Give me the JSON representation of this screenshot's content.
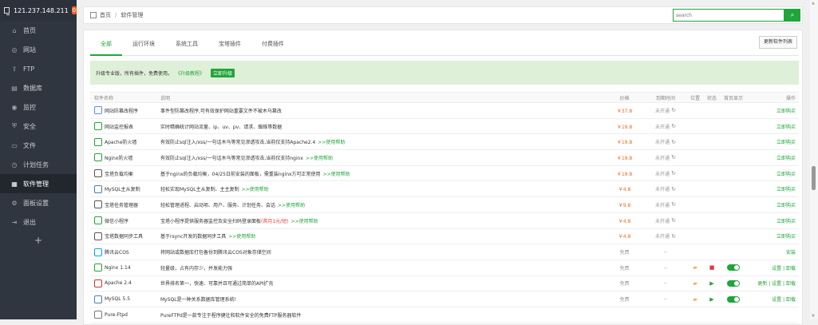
{
  "sidebar": {
    "server_ip": "121.237.148.211",
    "badge": "0",
    "items": [
      {
        "label": "首页",
        "icon": "home-icon",
        "glyph": "⌂"
      },
      {
        "label": "网站",
        "icon": "globe-icon",
        "glyph": "◎"
      },
      {
        "label": "FTP",
        "icon": "upload-icon",
        "glyph": "⇪"
      },
      {
        "label": "数据库",
        "icon": "database-icon",
        "glyph": "▤"
      },
      {
        "label": "监控",
        "icon": "monitor-icon",
        "glyph": "◉"
      },
      {
        "label": "安全",
        "icon": "shield-icon",
        "glyph": "⛨"
      },
      {
        "label": "文件",
        "icon": "folder-icon",
        "glyph": "▭"
      },
      {
        "label": "计划任务",
        "icon": "clock-icon",
        "glyph": "◷"
      },
      {
        "label": "软件管理",
        "icon": "grid-icon",
        "glyph": "▦",
        "active": true
      },
      {
        "label": "面板设置",
        "icon": "gear-icon",
        "glyph": "⚙"
      },
      {
        "label": "退出",
        "icon": "exit-icon",
        "glyph": "⇥"
      }
    ],
    "add": "+"
  },
  "breadcrumb": {
    "home": "首页",
    "sep": "/",
    "current": "软件管理"
  },
  "search": {
    "placeholder": "search",
    "button": "⌕"
  },
  "tabs": [
    "全部",
    "运行环境",
    "系统工具",
    "宝塔插件",
    "付费插件"
  ],
  "update_button": "更新软件列表",
  "promo": {
    "text": "升级专业版，所有插件，免费使用。",
    "link": "《升级教程》",
    "button": "立即升级"
  },
  "table": {
    "headers": {
      "name": "软件名称",
      "desc": "说明",
      "price": "价格",
      "expire": "到期时间",
      "pos": "位置",
      "status": "状态",
      "home": "首页显示",
      "op": "操作"
    },
    "rows": [
      {
        "name": "网站防篡改程序",
        "desc": "事件型防篡改程序,可有效保护网站重要文件不被木马篡改",
        "extra": "",
        "price": "￥37.8",
        "expire": "未开通",
        "refresh": "↻",
        "op": "立即购买",
        "icon_color": "#5b8def"
      },
      {
        "name": "网站监控报表",
        "desc": "实时精确统计网站流量、ip、uv、pv、请求、蜘蛛等数据",
        "extra": "",
        "price": "￥19.8",
        "expire": "未开通",
        "refresh": "↻",
        "op": "立即购买",
        "icon_color": "#20a53a"
      },
      {
        "name": "Apache防火墙",
        "desc": "有效防止sql注入/xss/一句话木马等常见渗透攻击,当前仅支持Apache2.4",
        "extra": ">>使用帮助",
        "price": "￥19.8",
        "expire": "未开通",
        "refresh": "↻",
        "op": "立即购买",
        "icon_color": "#20a53a"
      },
      {
        "name": "Nginx防火墙",
        "desc": "有效防止sql注入/xss/一句话木马等常见渗透攻击,当前仅支持nginx",
        "extra": ">>使用帮助",
        "price": "￥19.8",
        "expire": "未开通",
        "refresh": "↻",
        "op": "立即购买",
        "icon_color": "#20a53a"
      },
      {
        "name": "宝塔负载均衡",
        "desc": "基于nginx的负载均衡，04/25日前安装的面板，需重装nginx方可正常使用",
        "extra": ">>使用帮助",
        "price": "￥19.8",
        "expire": "未开通",
        "refresh": "↻",
        "op": "立即购买",
        "icon_color": "#555"
      },
      {
        "name": "MySQL主从复制",
        "desc": "轻松实现MySQL主从复制、主主复制",
        "extra": ">>使用帮助",
        "price": "￥4.8",
        "expire": "未开通",
        "refresh": "↻",
        "op": "立即购买",
        "icon_color": "#4a7bb7"
      },
      {
        "name": "宝塔任务管理器",
        "desc": "轻松管理进程、启动项、用户、服务、计划任务、会话",
        "extra": ">>使用帮助",
        "price": "￥9.8",
        "expire": "未开通",
        "refresh": "↻",
        "op": "立即购买",
        "icon_color": "#555"
      },
      {
        "name": "微信小程序",
        "desc": "宝塔小程序提供服务器监控及安全扫码登录面板",
        "red": "(首月1元/短)",
        "extra": ">>使用帮助",
        "price": "￥4.8",
        "expire": "未开通",
        "refresh": "↻",
        "op": "立即购买",
        "icon_color": "#20a53a"
      },
      {
        "name": "宝塔数据同步工具",
        "desc": "基于rsync开发的数据同步工具",
        "extra": ">>使用帮助",
        "price": "￥4.8",
        "expire": "未开通",
        "refresh": "↻",
        "op": "立即购买",
        "icon_color": "#555"
      },
      {
        "name": "腾讯云COS",
        "desc": "将网站或数据库打包备份到腾讯云COS对象存储空间",
        "extra": "",
        "price": "免费",
        "expire": "--",
        "refresh": "",
        "op": "安装",
        "icon_color": "#00a3ff"
      },
      {
        "name": "Nginx 1.14",
        "desc": "轻量级，占有内存少，并发能力强",
        "extra": "",
        "price": "免费",
        "expire": "--",
        "refresh": "",
        "pos": "▰",
        "status": "■",
        "status_color": "#e4393c",
        "toggle": true,
        "op": "设置 | 卸载",
        "icon_color": "#20a53a"
      },
      {
        "name": "Apache 2.4",
        "desc": "世界排名第一，快速、可靠并且可通过简单的API扩充",
        "extra": "",
        "price": "免费",
        "expire": "--",
        "refresh": "",
        "pos": "▰",
        "status": "▶",
        "status_color": "#20a53a",
        "toggle": true,
        "op": "更新 | 设置 | 卸载",
        "icon_color": "#c0392b"
      },
      {
        "name": "MySQL 5.5",
        "desc": "MySQL是一种关系数据库管理系统!",
        "extra": "",
        "price": "免费",
        "expire": "--",
        "refresh": "",
        "pos": "▰",
        "status": "▶",
        "status_color": "#20a53a",
        "toggle": true,
        "op": "设置 | 卸载",
        "icon_color": "#4a7bb7"
      },
      {
        "name": "Pure-Ftpd",
        "desc": "PureFTPd是一款专注于程序健壮和软件安全的免费FTP服务器软件",
        "extra": "",
        "price": "",
        "expire": "",
        "refresh": "",
        "op": "",
        "icon_color": "#777"
      }
    ]
  }
}
